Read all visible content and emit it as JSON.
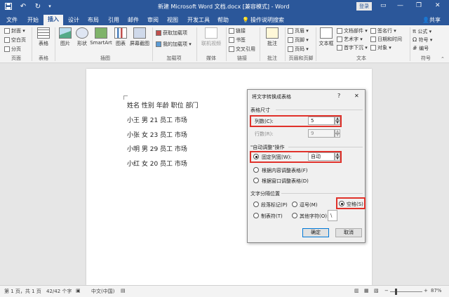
{
  "titlebar": {
    "title": "新建 Microsoft Word 文档.docx [兼容模式] - Word",
    "login_label": "登录",
    "minimize_glyph": "—",
    "restore_glyph": "❐",
    "close_glyph": "✕",
    "ribbon_display_glyph": "▭"
  },
  "tabs": [
    "文件",
    "开始",
    "插入",
    "设计",
    "布局",
    "引用",
    "邮件",
    "审阅",
    "视图",
    "开发工具",
    "帮助"
  ],
  "tellme": "操作说明搜索",
  "share": "共享",
  "ribbon": {
    "pages": {
      "cover": "封面",
      "blank": "空白页",
      "break": "分页",
      "group": "页面"
    },
    "tables": {
      "table": "表格",
      "group": "表格"
    },
    "illustrations": {
      "picture": "图片",
      "shapes": "形状",
      "smartart": "SmartArt",
      "chart": "图表",
      "screenshot": "屏幕截图",
      "group": "插图"
    },
    "addins": {
      "get": "获取加载项",
      "my": "我的加载项",
      "group": "加载项"
    },
    "media": {
      "video": "联机视频",
      "group": "媒体"
    },
    "links": {
      "link": "链接",
      "bookmark": "书签",
      "crossref": "交叉引用",
      "group": "链接"
    },
    "comments": {
      "comment": "批注",
      "group": "批注"
    },
    "headerfooter": {
      "header": "页眉",
      "footer": "页脚",
      "pagenum": "页码",
      "group": "页眉和页脚"
    },
    "text": {
      "textbox": "文本框",
      "parts": "文档部件",
      "wordart": "艺术字",
      "dropcap": "首字下沉",
      "sigline": "签名行",
      "datetime": "日期和时间",
      "object": "对象",
      "group": "文本"
    },
    "symbols": {
      "equation": "公式",
      "symbol": "符号",
      "number": "编号",
      "group": "符号"
    }
  },
  "document": {
    "lines": [
      "姓名 性别 年龄 职位 部门",
      "小王 男 21 员工 市场",
      "小张 女 23 员工 市场",
      "小明 男 29 员工 市场",
      "小红 女 20 员工 市场"
    ]
  },
  "dialog": {
    "title": "将文字转换成表格",
    "help_glyph": "?",
    "close_glyph": "✕",
    "size_section": "表格尺寸",
    "columns_label": "列数(C):",
    "columns_value": "5",
    "rows_label": "行数(R):",
    "rows_value": "9",
    "autofit_section": "\"自动调整\"操作",
    "fixed_width_label": "固定列宽(W):",
    "fixed_width_value": "自动",
    "fit_content_label": "根据内容调整表格(F)",
    "fit_window_label": "根据窗口调整表格(D)",
    "separator_section": "文字分隔位置",
    "sep_paragraph": "段落标记(P)",
    "sep_comma": "逗号(M)",
    "sep_space": "空格(S)",
    "sep_tab": "制表符(T)",
    "sep_other": "其他字符(O):",
    "sep_other_value": "\\",
    "ok": "确定",
    "cancel": "取消"
  },
  "statusbar": {
    "page": "第 1 页，共 1 页",
    "words": "42/42 个字",
    "lang": "中文(中国)",
    "zoom": "87%"
  },
  "colors": {
    "accent": "#2b579a",
    "highlight": "#e0312a"
  }
}
